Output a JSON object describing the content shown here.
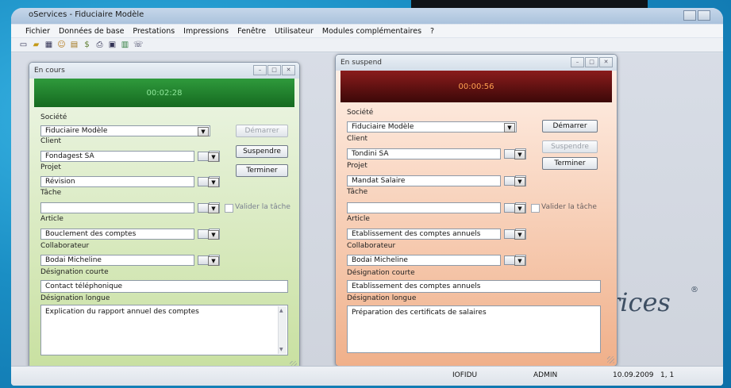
{
  "app": {
    "title": "oServices - Fiduciaire Modèle"
  },
  "menu": [
    "Fichier",
    "Données de base",
    "Prestations",
    "Impressions",
    "Fenêtre",
    "Utilisateur",
    "Modules complémentaires",
    "?"
  ],
  "toolbar_icons": [
    "new-doc-icon",
    "open-folder-icon",
    "table-icon",
    "users-icon",
    "card-icon",
    "money-icon",
    "printer-icon",
    "report-icon",
    "book-icon",
    "contact-icon"
  ],
  "colors": {
    "running_header": "#1e7a2a",
    "running_timer_text": "#8fe59a",
    "suspended_header": "#5a1010",
    "suspended_timer_text": "#ffa050"
  },
  "window_left": {
    "title": "En cours",
    "timer": "00:02:28",
    "labels": {
      "societe": "Société",
      "client": "Client",
      "projet": "Projet",
      "tache": "Tâche",
      "article": "Article",
      "collaborateur": "Collaborateur",
      "desig_courte": "Désignation courte",
      "desig_longue": "Désignation longue"
    },
    "values": {
      "societe": "Fiduciaire Modèle",
      "client": "Fondagest SA",
      "projet": "Révision",
      "tache": "",
      "article": "Bouclement des comptes",
      "collaborateur": "Bodai Micheline",
      "desig_courte": "Contact téléphonique",
      "desig_longue": "Explication du rapport annuel des comptes"
    },
    "buttons": {
      "demarrer": "Démarrer",
      "suspendre": "Suspendre",
      "terminer": "Terminer"
    },
    "valider": "Valider la tâche"
  },
  "window_right": {
    "title": "En suspend",
    "timer": "00:00:56",
    "labels": {
      "societe": "Société",
      "client": "Client",
      "projet": "Projet",
      "tache": "Tâche",
      "article": "Article",
      "collaborateur": "Collaborateur",
      "desig_courte": "Désignation courte",
      "desig_longue": "Désignation longue"
    },
    "values": {
      "societe": "Fiduciaire Modèle",
      "client": "Tondini SA",
      "projet": "Mandat Salaire",
      "tache": "",
      "article": "Etablissement des comptes annuels",
      "collaborateur": "Bodai Micheline",
      "desig_courte": "Etablissement des comptes annuels",
      "desig_longue": "Préparation des certificats de salaires"
    },
    "buttons": {
      "demarrer": "Démarrer",
      "suspendre": "Suspendre",
      "terminer": "Terminer"
    },
    "valider": "Valider la tâche"
  },
  "logo": {
    "text": "rices",
    "reg": "®"
  },
  "status": {
    "code": "IOFIDU",
    "user": "ADMIN",
    "date": "10.09.2009",
    "pos": "1, 1"
  }
}
